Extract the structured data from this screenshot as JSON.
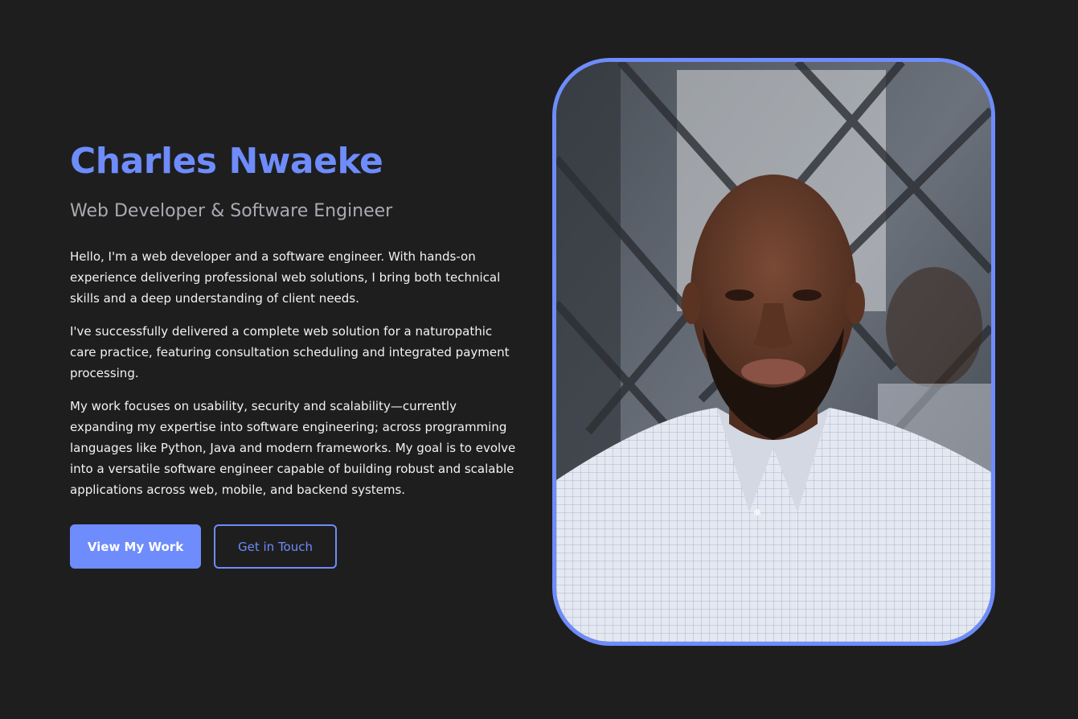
{
  "hero": {
    "name": "Charles Nwaeke",
    "role": "Web Developer & Software Engineer",
    "paragraphs": [
      "Hello, I'm a web developer and a software engineer. With hands-on experience delivering professional web solutions, I bring both technical skills and a deep understanding of client needs.",
      "I've successfully delivered a complete web solution for a naturopathic care practice, featuring consultation scheduling and integrated payment processing.",
      "My work focuses on usability, security and scalability—currently expanding my expertise into software engineering; across programming languages like Python, Java and modern frameworks. My goal is to evolve into a versatile software engineer capable of building robust and scalable applications across web, mobile, and backend systems."
    ],
    "buttons": {
      "primary_label": "View My Work",
      "secondary_label": "Get in Touch"
    }
  },
  "colors": {
    "background": "#1e1e1e",
    "accent": "#6e8cfb",
    "subtitle": "#a9abb3",
    "body_text": "#f2f2f2"
  },
  "photo": {
    "subject": "profile-photo"
  }
}
